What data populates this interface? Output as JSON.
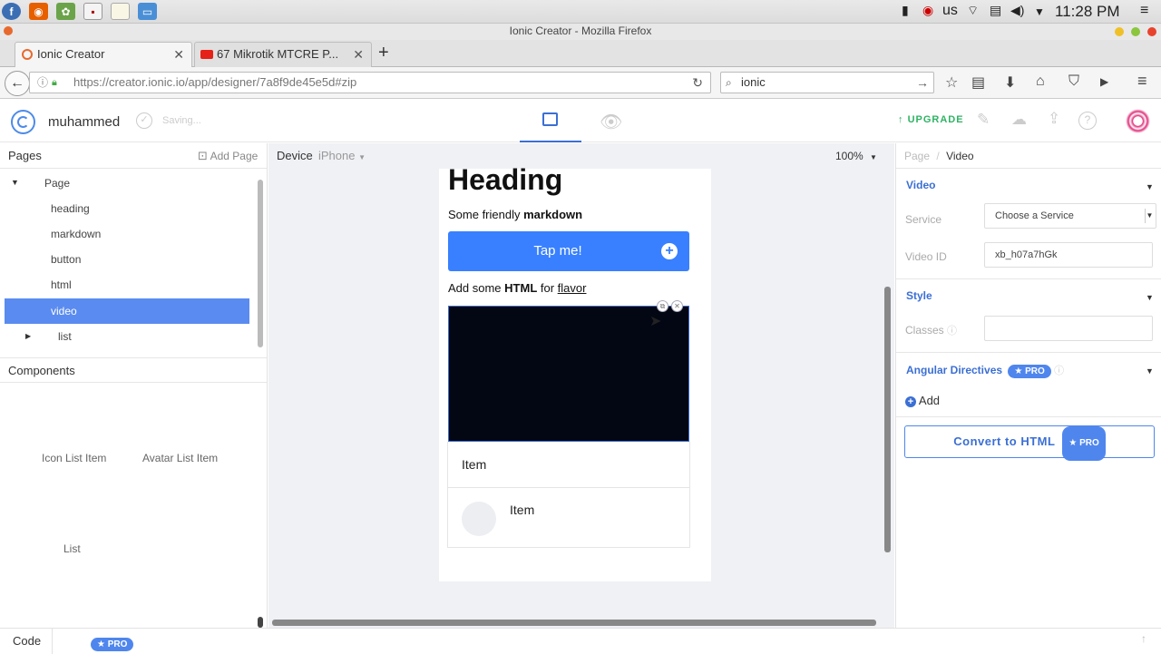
{
  "os_panel": {
    "keyboard_layout": "us",
    "clock": "11:28 PM"
  },
  "window": {
    "title": "Ionic Creator - Mozilla Firefox"
  },
  "tabs": [
    {
      "label": "Ionic Creator"
    },
    {
      "label": "67 Mikrotik MTCRE P..."
    }
  ],
  "navbar": {
    "url": "https://creator.ionic.io/app/designer/7a8f9de45e5d#zip",
    "search_value": "ionic"
  },
  "app_header": {
    "project_name": "muhammed",
    "saving_text": "Saving...",
    "upgrade_label": "UPGRADE"
  },
  "left_panel": {
    "pages_title": "Pages",
    "add_page_label": "Add Page",
    "tree": [
      "Page",
      "heading",
      "markdown",
      "button",
      "html",
      "video",
      "list"
    ],
    "components_title": "Components",
    "components": [
      "Icon List Item",
      "Avatar List Item",
      "List"
    ]
  },
  "canvas": {
    "device_label": "Device",
    "device_value": "iPhone",
    "zoom": "100%"
  },
  "preview": {
    "heading": "Heading",
    "markdown_prefix": "Some friendly ",
    "markdown_bold": "markdown",
    "button_label": "Tap me!",
    "html_prefix": "Add some ",
    "html_bold": "HTML",
    "html_mid": " for ",
    "html_link": "flavor",
    "list_items": [
      "Item",
      "Item"
    ]
  },
  "right_panel": {
    "breadcrumb_root": "Page",
    "breadcrumb_sep": "/",
    "breadcrumb_current": "Video",
    "video_section": "Video",
    "service_label": "Service",
    "service_value": "Choose a Service",
    "video_id_label": "Video ID",
    "video_id_value": "xb_h07a7hGk",
    "style_section": "Style",
    "classes_label": "Classes",
    "angular_section": "Angular Directives",
    "pro_label": "★ PRO",
    "add_label": "Add",
    "convert_label": "Convert to HTML"
  },
  "bottom_bar": {
    "code_label": "Code",
    "pro_label": "★ PRO"
  },
  "colors": {
    "accent": "#3b6fd4",
    "button_blue": "#3880ff",
    "selected_row": "#5a8bf0",
    "upgrade_green": "#2fb364"
  }
}
